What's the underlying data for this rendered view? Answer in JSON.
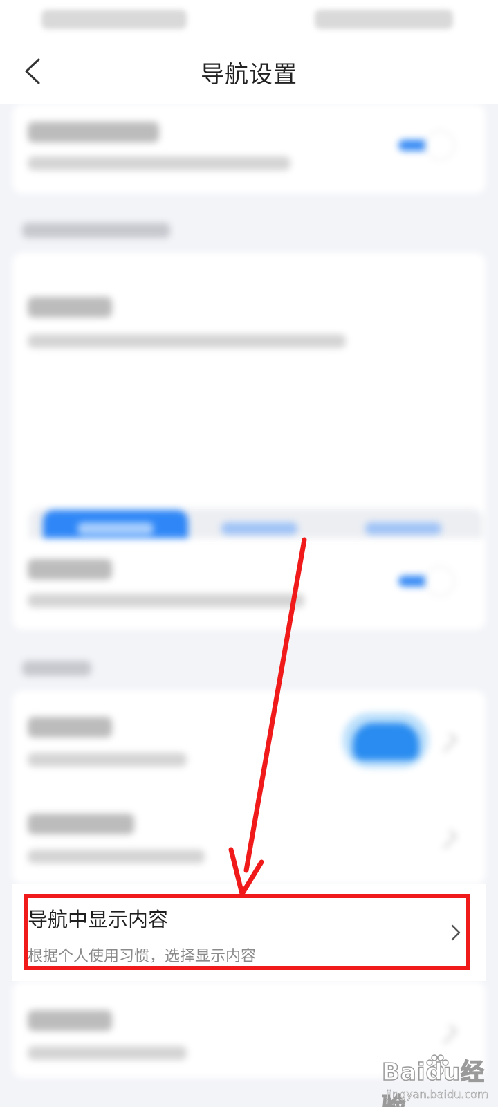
{
  "header": {
    "title": "导航设置"
  },
  "highlighted_row": {
    "title": "导航中显示内容",
    "subtitle": "根据个人使用习惯，选择显示内容"
  },
  "watermark": {
    "brand": "Baidu经验",
    "url": "jingyan.baidu.com"
  },
  "colors": {
    "accent": "#2f87f7",
    "annotation": "#f01a1a"
  }
}
